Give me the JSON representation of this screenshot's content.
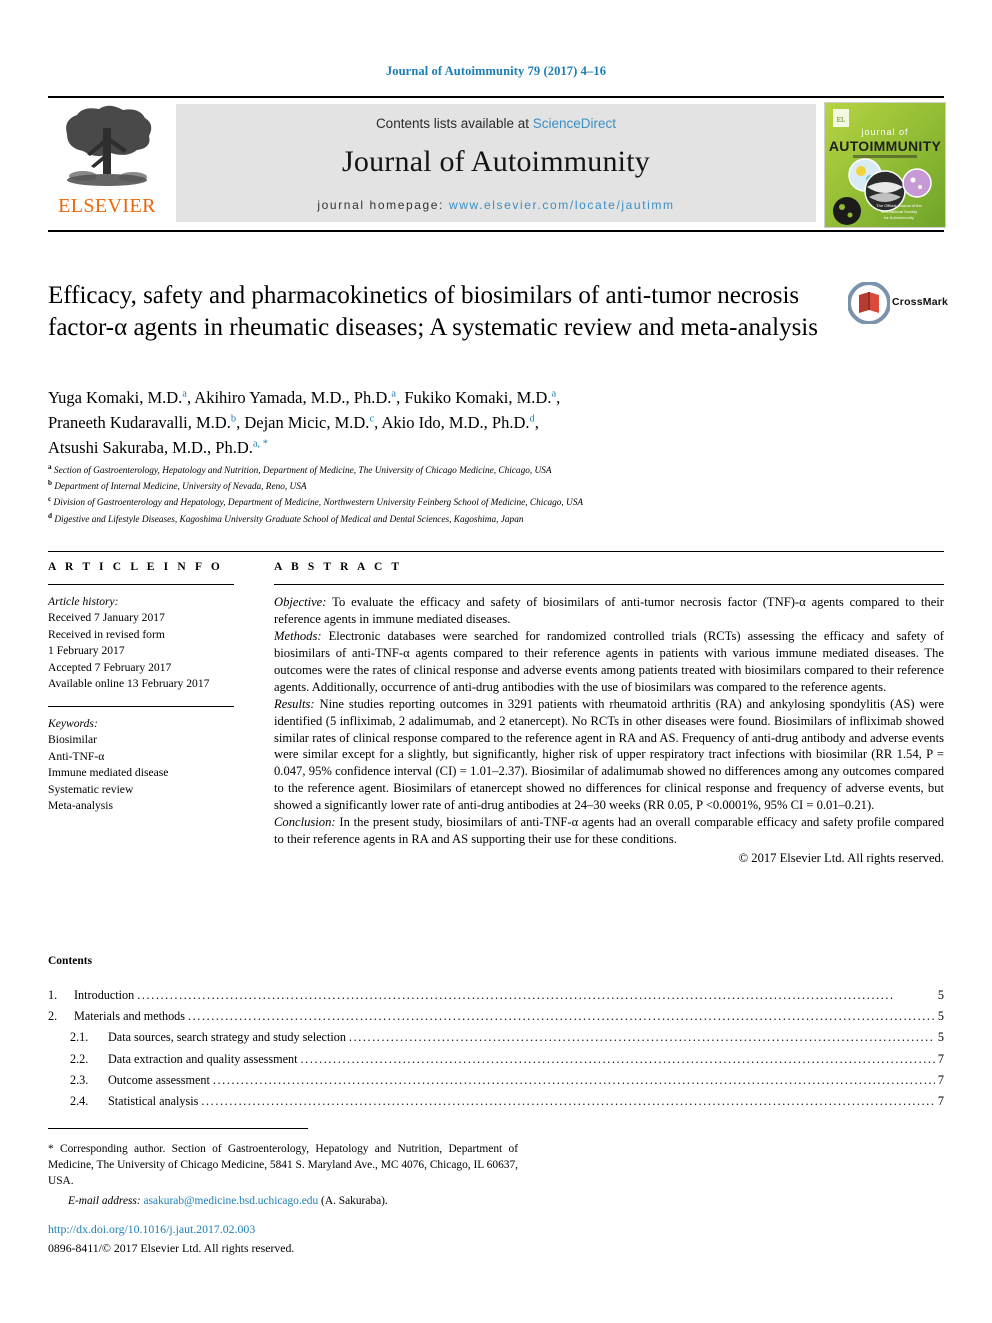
{
  "running_head": "Journal of Autoimmunity 79 (2017) 4–16",
  "masthead": {
    "publisher": "ELSEVIER",
    "contents_line_prefix": "Contents lists available at ",
    "contents_link": "ScienceDirect",
    "journal_title": "Journal of Autoimmunity",
    "homepage_prefix": "journal homepage: ",
    "homepage_link": "www.elsevier.com/locate/jautimm",
    "cover": {
      "line1": "journal of",
      "line2": "AUTOIMMUNITY",
      "line3": "OFFICIAL JOURNAL OF THE INTERNATIONAL SOCIETY"
    }
  },
  "article": {
    "title": "Efficacy, safety and pharmacokinetics of biosimilars of anti-tumor necrosis factor-α agents in rheumatic diseases; A systematic review and meta-analysis",
    "crossmark_label": "CrossMark",
    "authors_line1_a": "Yuga Komaki, M.D. ",
    "authors": [
      {
        "name": "Yuga Komaki, M.D.",
        "sup": "a",
        "sep": ", "
      },
      {
        "name": "Akihiro Yamada, M.D., Ph.D.",
        "sup": "a",
        "sep": ", "
      },
      {
        "name": "Fukiko Komaki, M.D.",
        "sup": "a",
        "sep": ","
      },
      {
        "name": "Praneeth Kudaravalli, M.D.",
        "sup": "b",
        "sep": ", "
      },
      {
        "name": "Dejan Micic, M.D.",
        "sup": "c",
        "sep": ", "
      },
      {
        "name": "Akio Ido, M.D., Ph.D.",
        "sup": "d",
        "sep": ","
      },
      {
        "name": "Atsushi Sakuraba, M.D., Ph.D.",
        "sup": "a, *",
        "sep": ""
      }
    ],
    "affiliations": [
      {
        "mark": "a",
        "text": "Section of Gastroenterology, Hepatology and Nutrition, Department of Medicine, The University of Chicago Medicine, Chicago, USA"
      },
      {
        "mark": "b",
        "text": "Department of Internal Medicine, University of Nevada, Reno, USA"
      },
      {
        "mark": "c",
        "text": "Division of Gastroenterology and Hepatology, Department of Medicine, Northwestern University Feinberg School of Medicine, Chicago, USA"
      },
      {
        "mark": "d",
        "text": "Digestive and Lifestyle Diseases, Kagoshima University Graduate School of Medical and Dental Sciences, Kagoshima, Japan"
      }
    ]
  },
  "article_info": {
    "heading": "A R T I C L E   I N F O",
    "history_label": "Article history:",
    "history": [
      "Received 7 January 2017",
      "Received in revised form",
      "1 February 2017",
      "Accepted 7 February 2017",
      "Available online 13 February 2017"
    ],
    "keywords_label": "Keywords:",
    "keywords": [
      "Biosimilar",
      "Anti-TNF-α",
      "Immune mediated disease",
      "Systematic review",
      "Meta-analysis"
    ]
  },
  "abstract": {
    "heading": "A B S T R A C T",
    "objective_label": "Objective:",
    "objective_text": " To evaluate the efficacy and safety of biosimilars of anti-tumor necrosis factor (TNF)-α agents compared to their reference agents in immune mediated diseases.",
    "methods_label": "Methods:",
    "methods_text": " Electronic databases were searched for randomized controlled trials (RCTs) assessing the efficacy and safety of biosimilars of anti-TNF-α agents compared to their reference agents in patients with various immune mediated diseases. The outcomes were the rates of clinical response and adverse events among patients treated with biosimilars compared to their reference agents. Additionally, occurrence of anti-drug antibodies with the use of biosimilars was compared to the reference agents.",
    "results_label": "Results:",
    "results_text": " Nine studies reporting outcomes in 3291 patients with rheumatoid arthritis (RA) and ankylosing spondylitis (AS) were identified (5 infliximab, 2 adalimumab, and 2 etanercept). No RCTs in other diseases were found. Biosimilars of infliximab showed similar rates of clinical response compared to the reference agent in RA and AS. Frequency of anti-drug antibody and adverse events were similar except for a slightly, but significantly, higher risk of upper respiratory tract infections with biosimilar (RR 1.54, P = 0.047, 95% confidence interval (CI) = 1.01–2.37). Biosimilar of adalimumab showed no differences among any outcomes compared to the reference agent. Biosimilars of etanercept showed no differences for clinical response and frequency of adverse events, but showed a significantly lower rate of anti-drug antibodies at 24–30 weeks (RR 0.05, P <0.0001%, 95% CI = 0.01–0.21).",
    "conclusion_label": "Conclusion:",
    "conclusion_text": " In the present study, biosimilars of anti-TNF-α agents had an overall comparable efficacy and safety profile compared to their reference agents in RA and AS supporting their use for these conditions.",
    "copyright": "© 2017 Elsevier Ltd. All rights reserved."
  },
  "contents": {
    "heading": "Contents",
    "entries": [
      {
        "num": "1.",
        "label": "Introduction",
        "page": "5",
        "level": 1
      },
      {
        "num": "2.",
        "label": "Materials and methods",
        "page": "5",
        "level": 1
      },
      {
        "num": "2.1.",
        "label": "Data sources, search strategy and study selection",
        "page": "5",
        "level": 2
      },
      {
        "num": "2.2.",
        "label": "Data extraction and quality assessment",
        "page": "7",
        "level": 2
      },
      {
        "num": "2.3.",
        "label": "Outcome assessment",
        "page": "7",
        "level": 2
      },
      {
        "num": "2.4.",
        "label": "Statistical analysis",
        "page": "7",
        "level": 2
      }
    ]
  },
  "footnote": {
    "corresponding": "* Corresponding author. Section of Gastroenterology, Hepatology and Nutrition, Department of Medicine, The University of Chicago Medicine, 5841 S. Maryland Ave., MC 4076, Chicago, IL 60637, USA.",
    "email_label": "E-mail address:",
    "email": "asakurab@medicine.bsd.uchicago.edu",
    "email_suffix": " (A. Sakuraba).",
    "doi": "http://dx.doi.org/10.1016/j.jaut.2017.02.003",
    "issn": "0896-8411/© 2017 Elsevier Ltd. All rights reserved."
  },
  "colors": {
    "link_blue": "#1b7db5",
    "sd_blue": "#3a8fc4",
    "elsevier_orange": "#eb6608",
    "masthead_gray": "#e3e3e3",
    "cover_green": "#9cc23c"
  }
}
